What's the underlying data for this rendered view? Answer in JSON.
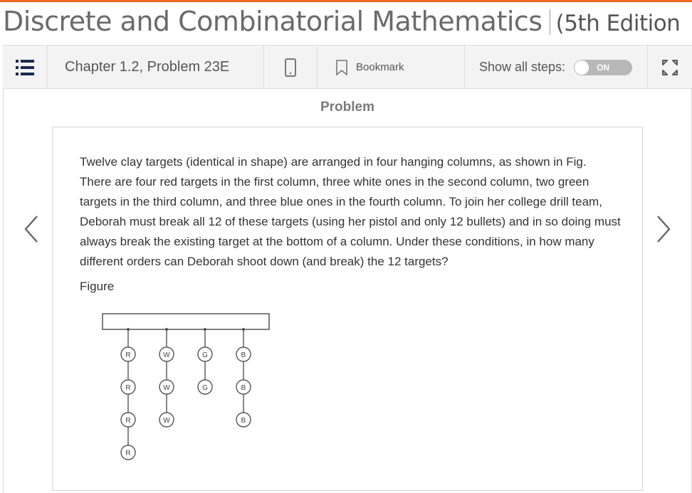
{
  "book": {
    "title": "Discrete and Combinatorial Mathematics",
    "edition": "(5th Edition"
  },
  "toolbar": {
    "chapter_label": "Chapter 1.2, Problem 23E",
    "bookmark_label": "Bookmark",
    "show_steps_label": "Show all steps:",
    "toggle_state": "ON"
  },
  "problem": {
    "heading": "Problem",
    "text": "Twelve clay targets (identical in shape) are arranged in four hanging columns, as shown in Fig. There are four red targets in the first column, three white ones in the second column, two green targets in the third column, and three blue ones in the fourth column. To join her college drill team, Deborah must break all 12 of these targets (using her pistol and only 12 bullets) and in so doing must always break the existing target at the bottom of a column. Under these conditions, in how many different orders can Deborah shoot down (and break) the 12 targets?",
    "figure_label": "Figure"
  },
  "figure": {
    "columns": [
      {
        "letter": "R",
        "count": 4
      },
      {
        "letter": "W",
        "count": 3
      },
      {
        "letter": "G",
        "count": 2
      },
      {
        "letter": "B",
        "count": 3
      }
    ]
  },
  "colors": {
    "accent": "#f26522",
    "toolbar_bg": "#f3f3f3",
    "toggle_bg": "#b8b8b8"
  },
  "icons": {
    "menu": "list-icon",
    "device": "mobile-device-icon",
    "bookmark": "bookmark-icon",
    "expand": "expand-icon",
    "prev": "chevron-left-icon",
    "next": "chevron-right-icon"
  }
}
